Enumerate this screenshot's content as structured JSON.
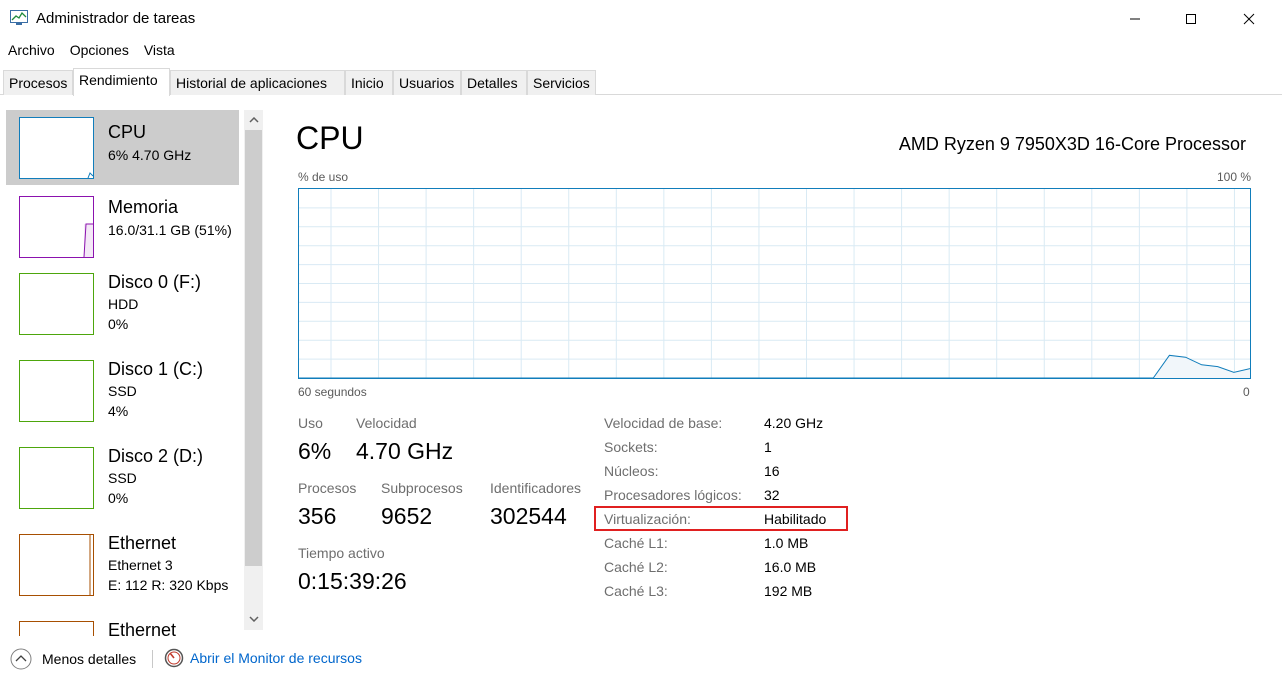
{
  "window": {
    "title": "Administrador de tareas"
  },
  "menu": [
    "Archivo",
    "Opciones",
    "Vista"
  ],
  "tabs": [
    "Procesos",
    "Rendimiento",
    "Historial de aplicaciones",
    "Inicio",
    "Usuarios",
    "Detalles",
    "Servicios"
  ],
  "active_tab": "Rendimiento",
  "sidebar": {
    "items": [
      {
        "title": "CPU",
        "line1": "6%  4.70 GHz",
        "line2": "",
        "color": "#117dbb",
        "selected": true
      },
      {
        "title": "Memoria",
        "line1": "16.0/31.1 GB (51%)",
        "line2": "",
        "color": "#8b12ae"
      },
      {
        "title": "Disco 0 (F:)",
        "line1": "HDD",
        "line2": "0%",
        "color": "#4da60c"
      },
      {
        "title": "Disco 1 (C:)",
        "line1": "SSD",
        "line2": "4%",
        "color": "#4da60c"
      },
      {
        "title": "Disco 2 (D:)",
        "line1": "SSD",
        "line2": "0%",
        "color": "#4da60c"
      },
      {
        "title": "Ethernet",
        "line1": "Ethernet 3",
        "line2": "E: 112 R: 320 Kbps",
        "color": "#a74f01"
      },
      {
        "title": "Ethernet",
        "line1": "",
        "line2": "",
        "color": "#a74f01"
      }
    ]
  },
  "main": {
    "title": "CPU",
    "processor": "AMD Ryzen 9 7950X3D 16-Core Processor",
    "graph": {
      "y_label": "% de uso",
      "y_max_label": "100 %",
      "x_label": "60 segundos",
      "x_min_label": "0",
      "line_color": "#117dbb",
      "history_percent": [
        0,
        0,
        0,
        0,
        0,
        0,
        0,
        0,
        0,
        0,
        0,
        0,
        0,
        0,
        0,
        0,
        0,
        0,
        0,
        0,
        0,
        0,
        0,
        0,
        0,
        0,
        0,
        0,
        0,
        0,
        0,
        0,
        0,
        0,
        0,
        0,
        0,
        0,
        0,
        0,
        0,
        0,
        0,
        0,
        0,
        0,
        0,
        0,
        0,
        0,
        0,
        0,
        0,
        0,
        12,
        11,
        7,
        6,
        3,
        5
      ]
    },
    "stats": {
      "uso_label": "Uso",
      "uso_value": "6%",
      "velocidad_label": "Velocidad",
      "velocidad_value": "4.70 GHz",
      "procesos_label": "Procesos",
      "procesos_value": "356",
      "subprocesos_label": "Subprocesos",
      "subprocesos_value": "9652",
      "identificadores_label": "Identificadores",
      "identificadores_value": "302544",
      "tiempo_label": "Tiempo activo",
      "tiempo_value": "0:15:39:26"
    },
    "details": [
      {
        "label": "Velocidad de base:",
        "value": "4.20 GHz"
      },
      {
        "label": "Sockets:",
        "value": "1"
      },
      {
        "label": "Núcleos:",
        "value": "16"
      },
      {
        "label": "Procesadores lógicos:",
        "value": "32"
      },
      {
        "label": "Virtualización:",
        "value": "Habilitado"
      },
      {
        "label": "Caché L1:",
        "value": "1.0 MB"
      },
      {
        "label": "Caché L2:",
        "value": "16.0 MB"
      },
      {
        "label": "Caché L3:",
        "value": "192 MB"
      }
    ]
  },
  "footer": {
    "less_details": "Menos detalles",
    "resource_monitor": "Abrir el Monitor de recursos"
  }
}
